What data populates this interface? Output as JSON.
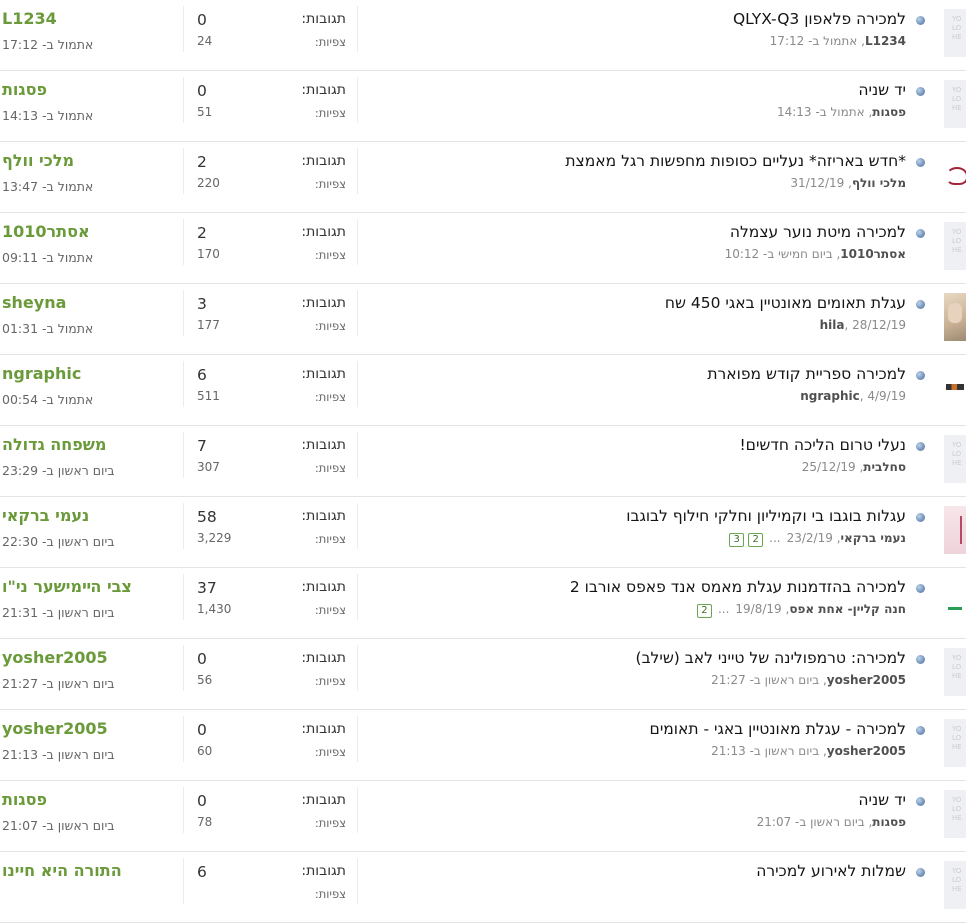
{
  "labels": {
    "replies": "תגובות:",
    "views": "צפיות:"
  },
  "colors": {
    "username": "#6a9a3a",
    "status_dot": "#7896bd",
    "page_link_border": "#6aa84f"
  },
  "threads": [
    {
      "title": "למכירה פלאפון QLYX-Q3",
      "author": "L1234",
      "started": ", אתמול ב- 17:12",
      "pages": [],
      "replies": "0",
      "views": "24",
      "last_user": "L1234",
      "last_time": "אתמול ב- 17:12",
      "avatar": "placeholder"
    },
    {
      "title": "יד שניה",
      "author": "פסגות",
      "started": ", אתמול ב- 14:13",
      "pages": [],
      "replies": "0",
      "views": "51",
      "last_user": "פסגות",
      "last_time": "אתמול ב- 14:13",
      "avatar": "placeholder"
    },
    {
      "title": "*חדש באריזה* נעליים כסופות מחפשות רגל מאמצת",
      "author": "מלכי וולף",
      "started": ", 31/12/19",
      "pages": [],
      "replies": "2",
      "views": "220",
      "last_user": "מלכי וולף",
      "last_time": "אתמול ב- 13:47",
      "avatar": "custom-red"
    },
    {
      "title": "למכירה מיטת נוער עצמלה",
      "author": "אסתר1010",
      "started": ", ביום חמישי ב- 10:12",
      "pages": [],
      "replies": "2",
      "views": "170",
      "last_user": "אסתר1010",
      "last_time": "אתמול ב- 09:11",
      "avatar": "placeholder"
    },
    {
      "title": "עגלת תאומים מאונטיין באגי 450 שח",
      "author": "hila",
      "started": ", 28/12/19",
      "pages": [],
      "replies": "3",
      "views": "177",
      "last_user": "sheyna",
      "last_time": "אתמול ב- 01:31",
      "avatar": "custom-photo"
    },
    {
      "title": "למכירה ספריית קודש מפוארת",
      "author": "ngraphic",
      "started": ", 4/9/19",
      "pages": [],
      "replies": "6",
      "views": "511",
      "last_user": "ngraphic",
      "last_time": "אתמול ב- 00:54",
      "avatar": "custom-logo"
    },
    {
      "title": "נעלי טרום הליכה חדשים!",
      "author": "סחלבית",
      "started": ", 25/12/19",
      "pages": [],
      "replies": "7",
      "views": "307",
      "last_user": "משפחה גדולה",
      "last_time": "ביום ראשון ב- 23:29",
      "avatar": "placeholder"
    },
    {
      "title": "עגלות בוגבו בי וקמיליון וחלקי חילוף לבוגבו",
      "author": "נעמי ברקאי",
      "started": ", 23/2/19",
      "pages": [
        "2",
        "3"
      ],
      "replies": "58",
      "views": "3,229",
      "last_user": "נעמי ברקאי",
      "last_time": "ביום ראשון ב- 22:30",
      "avatar": "custom-pink"
    },
    {
      "title": "למכירה בהזדמנות עגלת מאמס אנד פאפס אורבו 2",
      "author": "חנה קליין- אחת אפס",
      "started": ", 19/8/19",
      "pages": [
        "2"
      ],
      "replies": "37",
      "views": "1,430",
      "last_user": "צבי הײמישער ני\"ו",
      "last_time": "ביום ראשון ב- 21:31",
      "avatar": "custom-green"
    },
    {
      "title": "למכירה: טרמפולינה של טייני לאב (שילב)",
      "author": "yosher2005",
      "started": ", ביום ראשון ב- 21:27",
      "pages": [],
      "replies": "0",
      "views": "56",
      "last_user": "yosher2005",
      "last_time": "ביום ראשון ב- 21:27",
      "avatar": "placeholder"
    },
    {
      "title": "למכירה - עגלת מאונטיין באגי - תאומים",
      "author": "yosher2005",
      "started": ", ביום ראשון ב- 21:13",
      "pages": [],
      "replies": "0",
      "views": "60",
      "last_user": "yosher2005",
      "last_time": "ביום ראשון ב- 21:13",
      "avatar": "placeholder"
    },
    {
      "title": "יד שניה",
      "author": "פסגות",
      "started": ", ביום ראשון ב- 21:07",
      "pages": [],
      "replies": "0",
      "views": "78",
      "last_user": "פסגות",
      "last_time": "ביום ראשון ב- 21:07",
      "avatar": "placeholder"
    },
    {
      "title": "שמלות לאירוע למכירה",
      "author": "",
      "started": "",
      "pages": [],
      "replies": "6",
      "views": "",
      "last_user": "התורה היא חיינו",
      "last_time": "",
      "avatar": "placeholder"
    }
  ]
}
